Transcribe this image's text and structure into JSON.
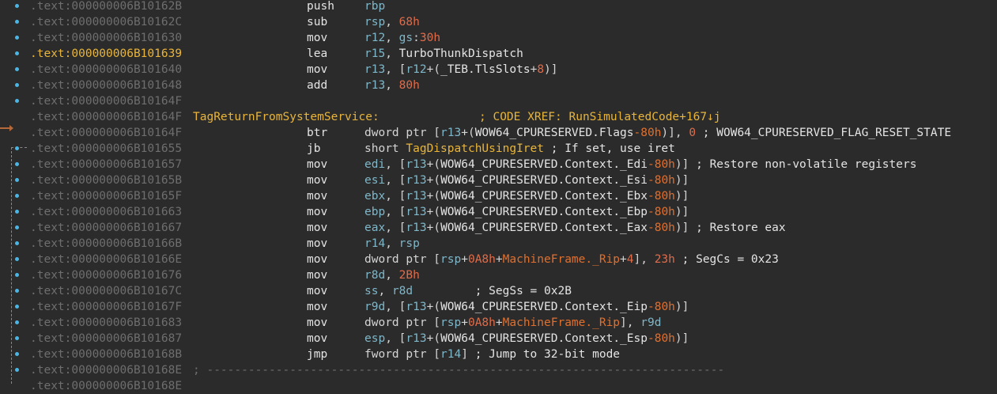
{
  "lines": [
    {
      "addr": ".text:000000006B10162B",
      "mnemonic": "push",
      "ops": [
        {
          "t": "reg",
          "v": "rbp"
        }
      ]
    },
    {
      "addr": ".text:000000006B10162C",
      "mnemonic": "sub",
      "ops": [
        {
          "t": "reg",
          "v": "rsp"
        },
        {
          "t": "br",
          "v": ", "
        },
        {
          "t": "num",
          "v": "68h"
        }
      ]
    },
    {
      "addr": ".text:000000006B101630",
      "mnemonic": "mov",
      "ops": [
        {
          "t": "reg",
          "v": "r12"
        },
        {
          "t": "br",
          "v": ", "
        },
        {
          "t": "reg",
          "v": "gs"
        },
        {
          "t": "br",
          "v": ":"
        },
        {
          "t": "num",
          "v": "30h"
        }
      ]
    },
    {
      "addr": ".text:000000006B101639",
      "addr_highlight": true,
      "mnemonic": "lea",
      "ops": [
        {
          "t": "reg",
          "v": "r15"
        },
        {
          "t": "br",
          "v": ", "
        },
        {
          "t": "sym",
          "v": "TurboThunkDispatch"
        }
      ]
    },
    {
      "addr": ".text:000000006B101640",
      "mnemonic": "mov",
      "ops": [
        {
          "t": "reg",
          "v": "r13"
        },
        {
          "t": "br",
          "v": ", ["
        },
        {
          "t": "reg",
          "v": "r12"
        },
        {
          "t": "br",
          "v": "+("
        },
        {
          "t": "struct",
          "v": "_TEB.TlsSlots"
        },
        {
          "t": "br",
          "v": "+"
        },
        {
          "t": "num",
          "v": "8"
        },
        {
          "t": "br",
          "v": ")]"
        }
      ]
    },
    {
      "addr": ".text:000000006B101648",
      "mnemonic": "add",
      "ops": [
        {
          "t": "reg",
          "v": "r13"
        },
        {
          "t": "br",
          "v": ", "
        },
        {
          "t": "num",
          "v": "80h"
        }
      ]
    },
    {
      "addr": ".text:000000006B10164F"
    },
    {
      "addr": ".text:000000006B10164F",
      "label": "TagReturnFromSystemService:",
      "xref": "; CODE XREF: RunSimulatedCode+167↓j"
    },
    {
      "addr": ".text:000000006B10164F",
      "mnemonic": "btr",
      "ops": [
        {
          "t": "br",
          "v": "dword ptr ["
        },
        {
          "t": "reg",
          "v": "r13"
        },
        {
          "t": "br",
          "v": "+("
        },
        {
          "t": "struct",
          "v": "WOW64_CPURESERVED.Flags"
        },
        {
          "t": "fld",
          "v": "-80h"
        },
        {
          "t": "br",
          "v": ")], "
        },
        {
          "t": "num",
          "v": "0"
        },
        {
          "t": "cmt",
          "v": " ; WOW64_CPURESERVED_FLAG_RESET_STATE"
        }
      ]
    },
    {
      "addr": ".text:000000006B101655",
      "mnemonic": "jb",
      "ops": [
        {
          "t": "br",
          "v": "short "
        },
        {
          "t": "lbl",
          "v": "TagDispatchUsingIret"
        },
        {
          "t": "cmt",
          "v": " ; If set, use iret"
        }
      ]
    },
    {
      "addr": ".text:000000006B101657",
      "mnemonic": "mov",
      "ops": [
        {
          "t": "reg",
          "v": "edi"
        },
        {
          "t": "br",
          "v": ", ["
        },
        {
          "t": "reg",
          "v": "r13"
        },
        {
          "t": "br",
          "v": "+("
        },
        {
          "t": "struct",
          "v": "WOW64_CPURESERVED.Context._Edi"
        },
        {
          "t": "fld",
          "v": "-80h"
        },
        {
          "t": "br",
          "v": ")]"
        },
        {
          "t": "cmt",
          "v": " ; Restore non-volatile registers"
        }
      ]
    },
    {
      "addr": ".text:000000006B10165B",
      "mnemonic": "mov",
      "ops": [
        {
          "t": "reg",
          "v": "esi"
        },
        {
          "t": "br",
          "v": ", ["
        },
        {
          "t": "reg",
          "v": "r13"
        },
        {
          "t": "br",
          "v": "+("
        },
        {
          "t": "struct",
          "v": "WOW64_CPURESERVED.Context._Esi"
        },
        {
          "t": "fld",
          "v": "-80h"
        },
        {
          "t": "br",
          "v": ")]"
        }
      ]
    },
    {
      "addr": ".text:000000006B10165F",
      "mnemonic": "mov",
      "ops": [
        {
          "t": "reg",
          "v": "ebx"
        },
        {
          "t": "br",
          "v": ", ["
        },
        {
          "t": "reg",
          "v": "r13"
        },
        {
          "t": "br",
          "v": "+("
        },
        {
          "t": "struct",
          "v": "WOW64_CPURESERVED.Context._Ebx"
        },
        {
          "t": "fld",
          "v": "-80h"
        },
        {
          "t": "br",
          "v": ")]"
        }
      ]
    },
    {
      "addr": ".text:000000006B101663",
      "mnemonic": "mov",
      "ops": [
        {
          "t": "reg",
          "v": "ebp"
        },
        {
          "t": "br",
          "v": ", ["
        },
        {
          "t": "reg",
          "v": "r13"
        },
        {
          "t": "br",
          "v": "+("
        },
        {
          "t": "struct",
          "v": "WOW64_CPURESERVED.Context._Ebp"
        },
        {
          "t": "fld",
          "v": "-80h"
        },
        {
          "t": "br",
          "v": ")]"
        }
      ]
    },
    {
      "addr": ".text:000000006B101667",
      "mnemonic": "mov",
      "ops": [
        {
          "t": "reg",
          "v": "eax"
        },
        {
          "t": "br",
          "v": ", ["
        },
        {
          "t": "reg",
          "v": "r13"
        },
        {
          "t": "br",
          "v": "+("
        },
        {
          "t": "struct",
          "v": "WOW64_CPURESERVED.Context._Eax"
        },
        {
          "t": "fld",
          "v": "-80h"
        },
        {
          "t": "br",
          "v": ")]"
        },
        {
          "t": "cmt",
          "v": " ; Restore eax"
        }
      ]
    },
    {
      "addr": ".text:000000006B10166B",
      "mnemonic": "mov",
      "ops": [
        {
          "t": "reg",
          "v": "r14"
        },
        {
          "t": "br",
          "v": ", "
        },
        {
          "t": "reg",
          "v": "rsp"
        }
      ]
    },
    {
      "addr": ".text:000000006B10166E",
      "mnemonic": "mov",
      "ops": [
        {
          "t": "br",
          "v": "dword ptr ["
        },
        {
          "t": "reg",
          "v": "rsp"
        },
        {
          "t": "br",
          "v": "+"
        },
        {
          "t": "num",
          "v": "0A8h"
        },
        {
          "t": "br",
          "v": "+"
        },
        {
          "t": "fld",
          "v": "MachineFrame._Rip"
        },
        {
          "t": "br",
          "v": "+"
        },
        {
          "t": "num",
          "v": "4"
        },
        {
          "t": "br",
          "v": "], "
        },
        {
          "t": "num",
          "v": "23h"
        },
        {
          "t": "cmt",
          "v": " ; SegCs = 0x23"
        }
      ]
    },
    {
      "addr": ".text:000000006B101676",
      "mnemonic": "mov",
      "ops": [
        {
          "t": "reg",
          "v": "r8d"
        },
        {
          "t": "br",
          "v": ", "
        },
        {
          "t": "num",
          "v": "2Bh"
        }
      ]
    },
    {
      "addr": ".text:000000006B10167C",
      "mnemonic": "mov",
      "ops": [
        {
          "t": "reg",
          "v": "ss"
        },
        {
          "t": "br",
          "v": ", "
        },
        {
          "t": "reg",
          "v": "r8d"
        },
        {
          "t": "cmt",
          "v": "         ; SegSs = 0x2B"
        }
      ]
    },
    {
      "addr": ".text:000000006B10167F",
      "mnemonic": "mov",
      "ops": [
        {
          "t": "reg",
          "v": "r9d"
        },
        {
          "t": "br",
          "v": ", ["
        },
        {
          "t": "reg",
          "v": "r13"
        },
        {
          "t": "br",
          "v": "+("
        },
        {
          "t": "struct",
          "v": "WOW64_CPURESERVED.Context._Eip"
        },
        {
          "t": "fld",
          "v": "-80h"
        },
        {
          "t": "br",
          "v": ")]"
        }
      ]
    },
    {
      "addr": ".text:000000006B101683",
      "mnemonic": "mov",
      "ops": [
        {
          "t": "br",
          "v": "dword ptr ["
        },
        {
          "t": "reg",
          "v": "rsp"
        },
        {
          "t": "br",
          "v": "+"
        },
        {
          "t": "num",
          "v": "0A8h"
        },
        {
          "t": "br",
          "v": "+"
        },
        {
          "t": "fld",
          "v": "MachineFrame._Rip"
        },
        {
          "t": "br",
          "v": "], "
        },
        {
          "t": "reg",
          "v": "r9d"
        }
      ]
    },
    {
      "addr": ".text:000000006B101687",
      "mnemonic": "mov",
      "ops": [
        {
          "t": "reg",
          "v": "esp"
        },
        {
          "t": "br",
          "v": ", ["
        },
        {
          "t": "reg",
          "v": "r13"
        },
        {
          "t": "br",
          "v": "+("
        },
        {
          "t": "struct",
          "v": "WOW64_CPURESERVED.Context._Esp"
        },
        {
          "t": "fld",
          "v": "-80h"
        },
        {
          "t": "br",
          "v": ")]"
        }
      ]
    },
    {
      "addr": ".text:000000006B10168B",
      "mnemonic": "jmp",
      "ops": [
        {
          "t": "br",
          "v": "fword ptr ["
        },
        {
          "t": "reg",
          "v": "r14"
        },
        {
          "t": "br",
          "v": "]"
        },
        {
          "t": "cmt",
          "v": " ; Jump to 32-bit mode"
        }
      ]
    },
    {
      "addr": ".text:000000006B10168E",
      "separator": "; ---------------------------------------------------------------------------"
    },
    {
      "addr": ".text:000000006B10168E"
    }
  ],
  "dotted_rows": [
    0,
    1,
    2,
    3,
    4,
    5,
    6,
    9,
    10,
    11,
    12,
    13,
    14,
    15,
    16,
    17,
    18,
    19,
    20,
    21,
    22,
    23
  ]
}
